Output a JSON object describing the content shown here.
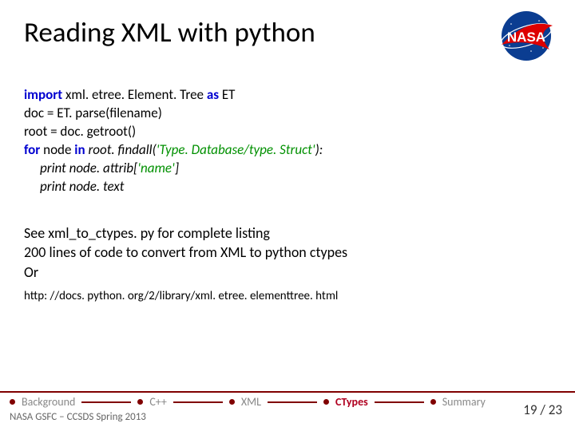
{
  "title": "Reading XML with python",
  "code": {
    "l1a": "import",
    "l1b": " xml. etree. Element. Tree ",
    "l1c": "as",
    "l1d": " ET",
    "l2": "doc =  ET. parse(filename)",
    "l3": "root = doc. getroot()",
    "l4a": "for",
    "l4b": " node ",
    "l4c": "in",
    "l4d": " root. findall(",
    "l4e": "'Type. Database/type. Struct'",
    "l4f": "):",
    "l5a": "print node. attrib[",
    "l5b": "'name'",
    "l5c": "]",
    "l6": "print node. text"
  },
  "note": {
    "l1": "See xml_to_ctypes. py for complete listing",
    "l2": "200 lines of code to convert from XML to python ctypes",
    "l3": "Or"
  },
  "url": "http: //docs. python. org/2/library/xml. etree. elementtree. html",
  "nav": {
    "items": [
      "Background",
      "C++",
      "XML",
      "CTypes",
      "Summary"
    ],
    "activeIndex": 3,
    "subtitle": "NASA GSFC – CCSDS Spring 2013"
  },
  "page": {
    "current": "19",
    "sep": " / ",
    "total": "23"
  },
  "logo": {
    "label": "NASA"
  }
}
